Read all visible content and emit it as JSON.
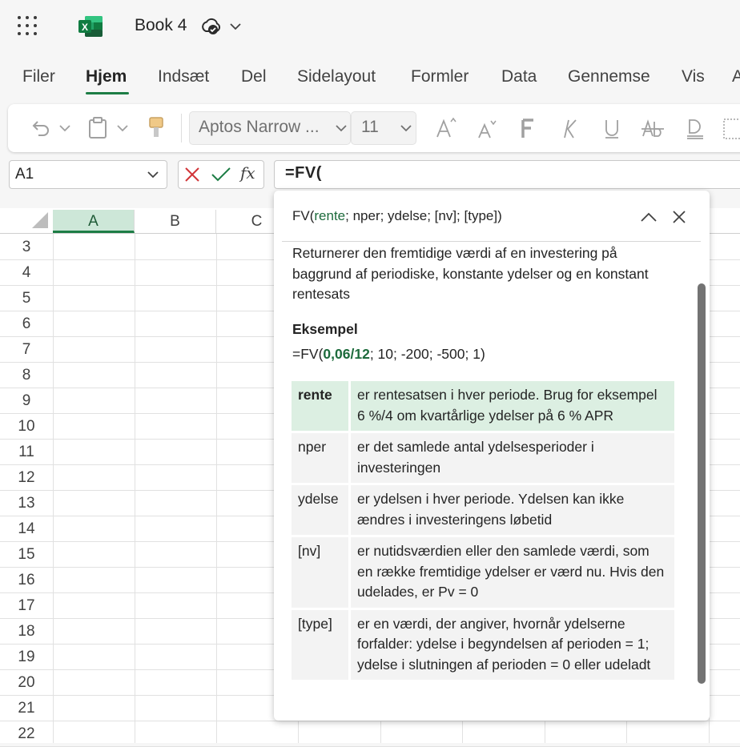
{
  "app": {
    "book_title": "Book 4",
    "logo_letter": "X",
    "brand_color": "#1d7d45"
  },
  "tabs": [
    "Filer",
    "Hjem",
    "Indsæt",
    "Del",
    "Sidelayout",
    "Formler",
    "Data",
    "Gennemse",
    "Vis",
    "A"
  ],
  "active_tab": "Hjem",
  "ribbon": {
    "font_name": "Aptos Narrow ...",
    "font_size": "11",
    "icons": [
      "undo-icon",
      "paste-icon",
      "format-painter-icon",
      "increase-font-icon",
      "decrease-font-icon",
      "bold-icon",
      "italic-icon",
      "underline-icon",
      "strikethrough-icon",
      "double-underline-icon",
      "borders-icon"
    ]
  },
  "formula_bar": {
    "name_box": "A1",
    "formula": "=FV(",
    "fx_label": "fx"
  },
  "grid": {
    "columns": [
      "A",
      "B",
      "C"
    ],
    "selected_column": "A",
    "rows": [
      "3",
      "4",
      "5",
      "6",
      "7",
      "8",
      "9",
      "10",
      "11",
      "12",
      "13",
      "14",
      "15",
      "16",
      "17",
      "18",
      "19",
      "20",
      "21",
      "22"
    ]
  },
  "tooltip": {
    "sig_name": "FV(",
    "sig_current_arg": "rente",
    "sig_rest": "; nper; ydelse; [nv]; [type])",
    "description": "Returnerer den fremtidige værdi af en investering på baggrund af periodiske, konstante ydelser og en konstant rentesats",
    "example_heading": "Eksempel",
    "example_prefix": "=FV(",
    "example_highlight": "0,06/12",
    "example_rest": "; 10; -200; -500; 1)",
    "args": [
      {
        "name": "rente",
        "desc": "er rentesatsen i hver periode. Brug for eksempel 6 %/4 om kvartårlige ydelser på 6 % APR",
        "active": true
      },
      {
        "name": "nper",
        "desc": "er det samlede antal ydelsesperioder i investeringen",
        "active": false
      },
      {
        "name": "ydelse",
        "desc": "er ydelsen i hver periode. Ydelsen kan ikke ændres i investeringens løbetid",
        "active": false
      },
      {
        "name": "[nv]",
        "desc": "er nutidsværdien eller den samlede værdi, som en række fremtidige ydelser er værd nu. Hvis den udelades, er Pv = 0",
        "active": false
      },
      {
        "name": "[type]",
        "desc": "er en værdi, der angiver, hvornår ydelserne forfalder: ydelse i begyndelsen af perioden = 1; ydelse i slutningen af perioden = 0 eller udeladt",
        "active": false
      }
    ]
  }
}
